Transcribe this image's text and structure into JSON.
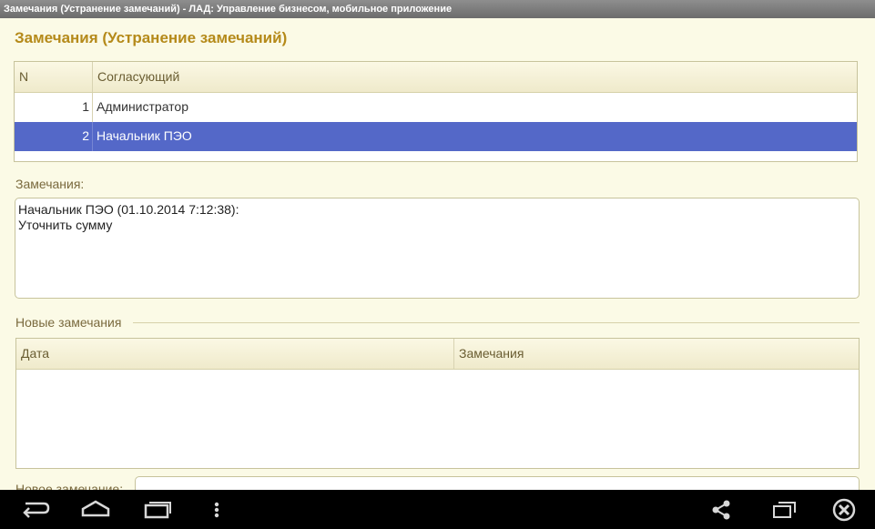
{
  "window": {
    "title": "Замечания (Устранение замечаний) - ЛАД: Управление бизнесом, мобильное приложение"
  },
  "form": {
    "title": "Замечания (Устранение замечаний)"
  },
  "approvers": {
    "columns": [
      "N",
      "Согласующий"
    ],
    "rows": [
      {
        "n": "1",
        "name": "Администратор"
      },
      {
        "n": "2",
        "name": "Начальник ПЭО"
      }
    ],
    "selected_index": 1
  },
  "comments": {
    "label": "Замечания:",
    "text": "Начальник ПЭО (01.10.2014 7:12:38):\nУточнить сумму"
  },
  "new_comments": {
    "group_label": "Новые замечания",
    "columns": [
      "Дата",
      "Замечания"
    ],
    "rows": []
  },
  "new_comment_field": {
    "label": "Новое замечание:",
    "value": ""
  },
  "navbar": {
    "buttons": [
      "back-icon",
      "home-icon",
      "recent-apps-icon",
      "menu-icon",
      "share-icon",
      "window-icon",
      "close-icon"
    ]
  },
  "colors": {
    "title": "#b58a1a",
    "background": "#fbfae6",
    "selection": "#5468c8"
  }
}
